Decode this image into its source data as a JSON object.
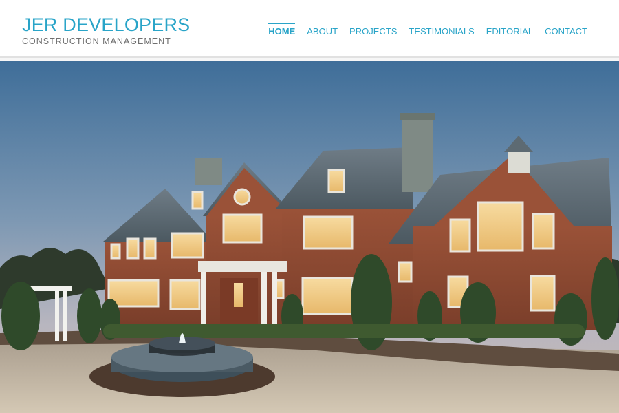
{
  "brand": {
    "name": "JER DEVELOPERS",
    "tagline": "CONSTRUCTION MANAGEMENT"
  },
  "nav": {
    "items": [
      {
        "label": "HOME",
        "active": true
      },
      {
        "label": "ABOUT",
        "active": false
      },
      {
        "label": "PROJECTS",
        "active": false
      },
      {
        "label": "TESTIMONIALS",
        "active": false
      },
      {
        "label": "EDITORIAL",
        "active": false
      },
      {
        "label": "CONTACT",
        "active": false
      }
    ]
  },
  "colors": {
    "accent": "#29a4c8",
    "tagline": "#6f6f6f"
  }
}
